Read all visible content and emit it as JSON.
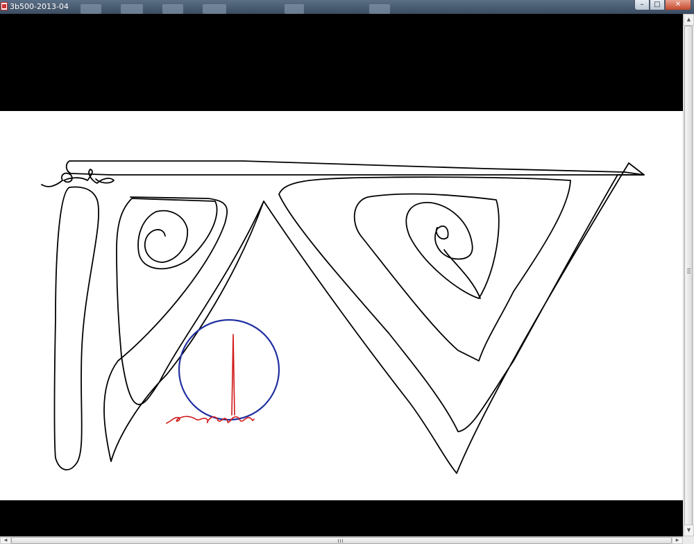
{
  "window": {
    "title": "3b500-2013-04",
    "controls": [
      {
        "name": "minimize",
        "glyph": "–"
      },
      {
        "name": "maximize",
        "glyph": "□"
      },
      {
        "name": "close",
        "glyph": "✕"
      }
    ],
    "app_icon": "image-viewer-icon",
    "taskbar_thumbnails": 6
  },
  "drawing": {
    "background": "#000000",
    "canvas_color": "#ffffff",
    "stroke_colors": {
      "outline": "#000000",
      "circle": "#1f2fa0",
      "scribble": "#d01818"
    }
  },
  "scrollbars": {
    "vertical_icons": [
      "scroll-up-icon",
      "scroll-down-icon"
    ],
    "horizontal_icons": [
      "scroll-left-icon",
      "scroll-right-icon"
    ]
  }
}
